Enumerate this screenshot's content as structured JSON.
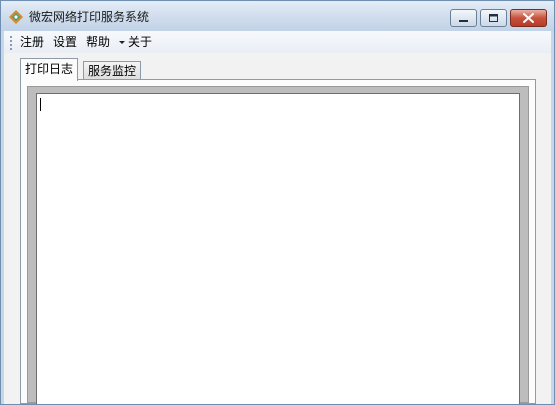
{
  "window": {
    "title": "微宏网络打印服务系统",
    "icon": "printer-app-icon"
  },
  "titlebar_buttons": {
    "minimize_icon": "minimize-icon",
    "maximize_icon": "maximize-icon",
    "close_icon": "close-icon"
  },
  "menubar": {
    "items": [
      {
        "label": "注册"
      },
      {
        "label": "设置"
      },
      {
        "label": "帮助",
        "has_dropdown": true
      },
      {
        "label": "关于"
      }
    ]
  },
  "tabs": [
    {
      "label": "打印日志",
      "active": true
    },
    {
      "label": "服务监控",
      "active": false
    }
  ],
  "log": {
    "content": ""
  }
}
